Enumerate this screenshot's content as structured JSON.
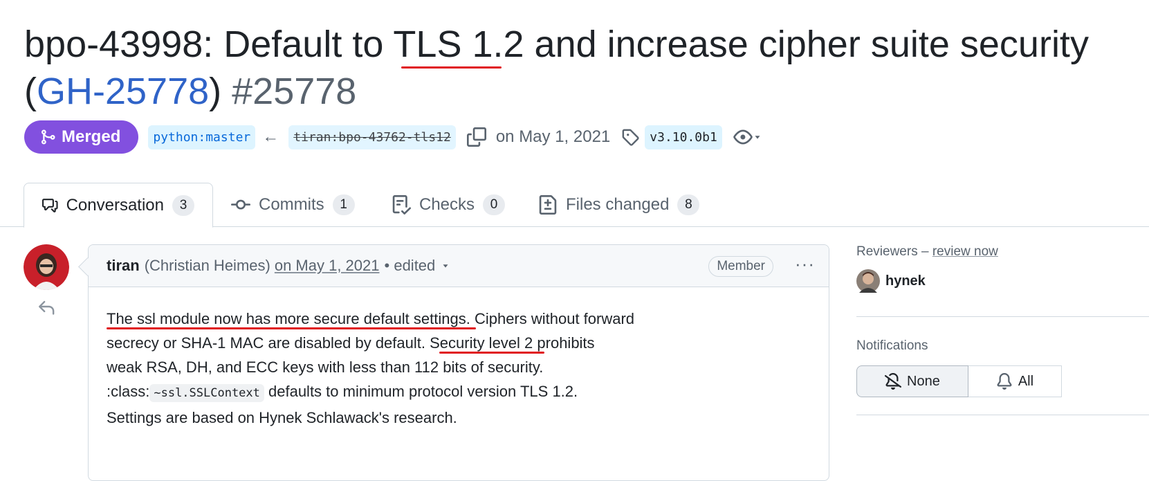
{
  "pr": {
    "title_part1": "bpo-43998: Default to ",
    "title_highlight": "TLS 1.2",
    "title_part2": " and increase cipher suite security",
    "title_open_paren": "(",
    "title_link": "GH-25778",
    "title_close_paren": ")",
    "number": "#25778"
  },
  "meta": {
    "status": "Merged",
    "base_branch": "python:master",
    "head_branch": "tiran:bpo-43762-tls12",
    "date_text": "on May 1, 2021",
    "tag": "v3.10.0b1"
  },
  "tabs": [
    {
      "label": "Conversation",
      "count": "3",
      "icon": "comment-discussion-icon"
    },
    {
      "label": "Commits",
      "count": "1",
      "icon": "commit-icon"
    },
    {
      "label": "Checks",
      "count": "0",
      "icon": "checklist-icon"
    },
    {
      "label": "Files changed",
      "count": "8",
      "icon": "file-diff-icon"
    }
  ],
  "comment": {
    "author": "tiran",
    "author_full": "(Christian Heimes)",
    "date": "on May 1, 2021",
    "edited": "• edited",
    "role": "Member",
    "menu": "···",
    "line1_underlined": "The ssl module now has more secure default settings",
    "line1_rest": ". Ciphers without forward",
    "line2_start": "secrecy or SHA-1 MAC are disabled by default. ",
    "line2_underlined": "Security level 2",
    "line2_rest": " prohibits",
    "line3": "weak RSA, DH, and ECC keys with less than 112 bits of security.",
    "line4_prefix": ":class:",
    "line4_code": "~ssl.SSLContext",
    "line4_rest": " defaults to minimum protocol version TLS 1.2.",
    "line5": "Settings are based on Hynek Schlawack's research."
  },
  "sidebar": {
    "reviewers_label": "Reviewers",
    "reviewers_dash": " – ",
    "review_now": "review now",
    "reviewer_name": "hynek",
    "notifications_label": "Notifications",
    "notif_none": "None",
    "notif_all": "All"
  },
  "colors": {
    "merged": "#8250df",
    "link": "#2f63c8",
    "annotation_red": "#e0141a"
  }
}
